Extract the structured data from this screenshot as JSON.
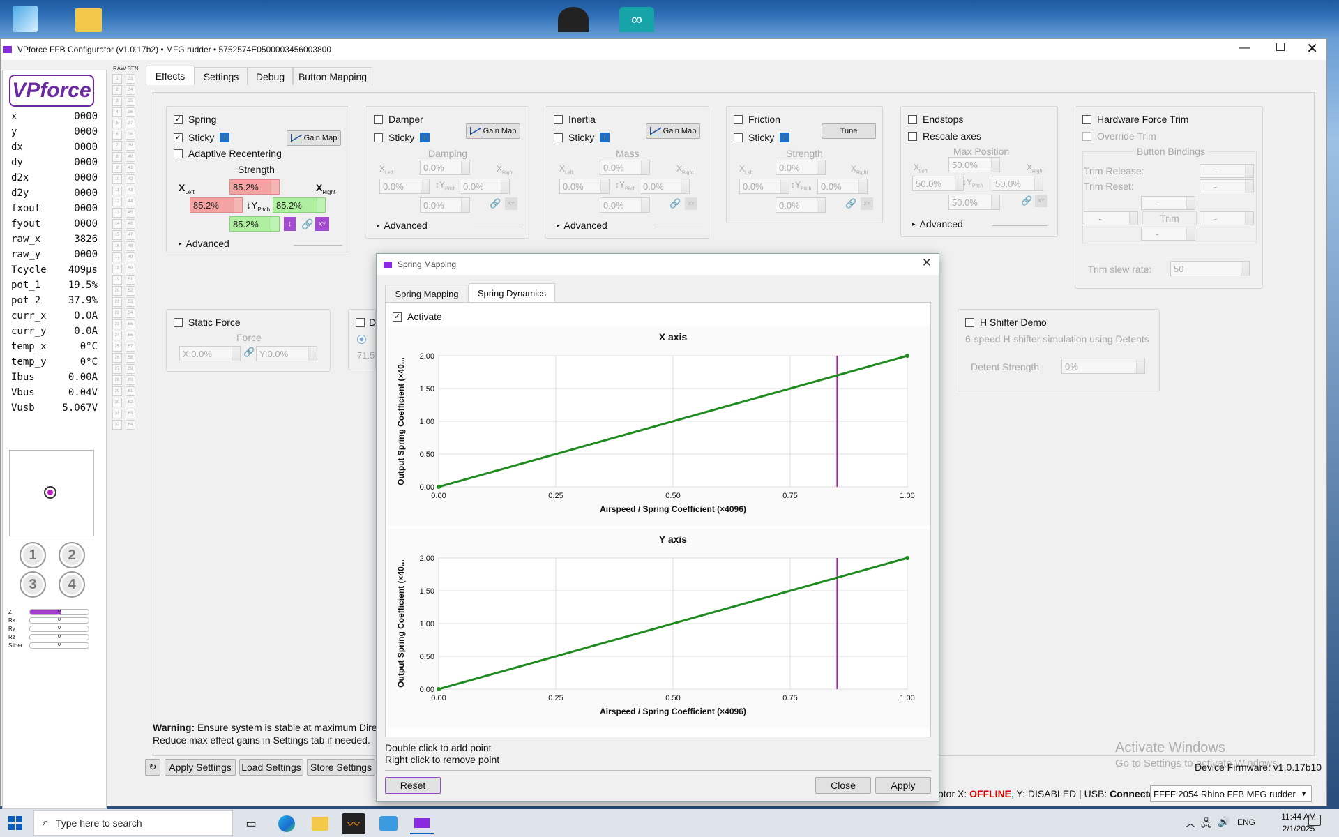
{
  "window": {
    "title": "VPforce FFB Configurator (v1.0.17b2) • MFG rudder • 5752574E0500003456003800"
  },
  "logo": "VPforce",
  "telemetry": [
    {
      "k": "x",
      "v": "0000"
    },
    {
      "k": "y",
      "v": "0000"
    },
    {
      "k": "dx",
      "v": "0000"
    },
    {
      "k": "dy",
      "v": "0000"
    },
    {
      "k": "d2x",
      "v": "0000"
    },
    {
      "k": "d2y",
      "v": "0000"
    },
    {
      "k": "fxout",
      "v": "0000"
    },
    {
      "k": "fyout",
      "v": "0000"
    },
    {
      "k": "raw_x",
      "v": "3826"
    },
    {
      "k": "raw_y",
      "v": "0000"
    },
    {
      "k": "Tcycle",
      "v": "409μs"
    },
    {
      "k": "pot_1",
      "v": "19.5%"
    },
    {
      "k": "pot_2",
      "v": "37.9%"
    },
    {
      "k": "curr_x",
      "v": "0.0A"
    },
    {
      "k": "curr_y",
      "v": "0.0A"
    },
    {
      "k": "temp_x",
      "v": "0°C"
    },
    {
      "k": "temp_y",
      "v": "0°C"
    },
    {
      "k": "Ibus",
      "v": "0.00A"
    },
    {
      "k": "Vbus",
      "v": "0.04V"
    },
    {
      "k": "Vusb",
      "v": "5.067V"
    }
  ],
  "hat_buttons": [
    "1",
    "2",
    "3",
    "4"
  ],
  "axes_bars": [
    {
      "label": "Z",
      "value": "0",
      "fill": 0.52
    },
    {
      "label": "Rx",
      "value": "0",
      "fill": 0
    },
    {
      "label": "Ry",
      "value": "0",
      "fill": 0
    },
    {
      "label": "Rz",
      "value": "0",
      "fill": 0
    },
    {
      "label": "Slider",
      "value": "0",
      "fill": 0
    }
  ],
  "raw_btn_header": "RAW BTN",
  "raw_btn_count": 64,
  "main_tabs": [
    "Effects",
    "Settings",
    "Debug",
    "Button Mapping"
  ],
  "spring": {
    "label": "Spring",
    "sticky": "Sticky",
    "info": "i",
    "gain_map": "Gain Map",
    "adaptive": "Adaptive Recentering",
    "strength": "Strength",
    "x_left": "X",
    "x_left_sub": "Left",
    "x_right": "X",
    "x_right_sub": "Right",
    "y_pitch": "↕Y",
    "y_pitch_sub": "Pitch",
    "v_top": "85.2%",
    "v_left": "85.2%",
    "v_right": "85.2%",
    "v_bottom": "85.2%",
    "link_i": "↕",
    "xy": "XY",
    "advanced": "Advanced",
    "check_mark": "✓"
  },
  "damper": {
    "label": "Damper",
    "sticky": "Sticky",
    "info": "i",
    "gain_map": "Gain Map",
    "group": "Damping",
    "v1": "0.0%",
    "v2": "0.0%",
    "v3": "0.0%",
    "v4": "0.0%",
    "advanced": "Advanced"
  },
  "inertia": {
    "label": "Inertia",
    "sticky": "Sticky",
    "info": "i",
    "gain_map": "Gain Map",
    "group": "Mass",
    "v1": "0.0%",
    "v2": "0.0%",
    "v3": "0.0%",
    "v4": "0.0%",
    "advanced": "Advanced"
  },
  "friction": {
    "label": "Friction",
    "sticky": "Sticky",
    "info": "i",
    "tune": "Tune",
    "group": "Strength",
    "v1": "0.0%",
    "v2": "0.0%",
    "v3": "0.0%",
    "v4": "0.0%"
  },
  "endstops": {
    "label": "Endstops",
    "rescale": "Rescale axes",
    "group": "Max Position",
    "v1": "50.0%",
    "v2": "50.0%",
    "v3": "50.0%",
    "v4": "50.0%",
    "advanced": "Advanced"
  },
  "xy_sub": {
    "x_left": "X",
    "left": "Left",
    "x_right": "X",
    "right": "Right",
    "y": "↕Y",
    "pitch": "Pitch",
    "xy": "XY"
  },
  "hw_trim": {
    "label": "Hardware Force Trim",
    "override": "Override Trim",
    "bindings": "Button Bindings",
    "trim_release": "Trim Release:",
    "trim_reset": "Trim Reset:",
    "trim": "Trim",
    "dash": "-",
    "slew_label": "Trim slew rate:",
    "slew_value": "50"
  },
  "static_force": {
    "label": "Static Force",
    "group": "Force",
    "x": "X:0.0%",
    "y": "Y:0.0%"
  },
  "partial_panel": {
    "label": "De",
    "value": "71.5"
  },
  "h_shifter": {
    "label": "H Shifter Demo",
    "desc": "6-speed H-shifter simulation using Detents",
    "strength_label": "Detent Strength",
    "strength_value": "0%"
  },
  "warning": {
    "bold": "Warning:",
    "line1": " Ensure system is stable at maximum Direc",
    "line2": "Reduce max effect gains in Settings tab if needed."
  },
  "bottom_buttons": {
    "refresh": "↻",
    "apply": "Apply Settings",
    "load": "Load Settings",
    "store": "Store Settings"
  },
  "status": {
    "prefix": "otor X: ",
    "offline": "OFFLINE",
    "mid": ", Y: DISABLED | USB: ",
    "connected": "Connected"
  },
  "device_select": "FFFF:2054 Rhino FFB MFG rudder",
  "firmware": "Device Firmware: v1.0.17b10",
  "activate_windows": {
    "title": "Activate Windows",
    "sub": "Go to Settings to activate Windows."
  },
  "dialog": {
    "title": "Spring Mapping",
    "tabs": [
      "Spring Mapping",
      "Spring Dynamics"
    ],
    "activate": "Activate",
    "hint1": "Double click to add point",
    "hint2": "Right click to remove point",
    "reset": "Reset",
    "close": "Close",
    "apply": "Apply"
  },
  "chart_data": [
    {
      "type": "line",
      "title": "X axis",
      "xlabel": "Airspeed / Spring Coefficient (×4096)",
      "ylabel": "Output Spring Coefficient (×40...",
      "xlim": [
        0,
        1
      ],
      "ylim": [
        0,
        2
      ],
      "xticks": [
        "0.00",
        "0.25",
        "0.50",
        "0.75",
        "1.00"
      ],
      "yticks": [
        "0.00",
        "0.50",
        "1.00",
        "1.50",
        "2.00"
      ],
      "series": [
        {
          "x": [
            0,
            1
          ],
          "y": [
            0,
            2
          ]
        }
      ],
      "marker_x": 0.85,
      "line_color": "#1f8a1f",
      "marker_color": "#c000c0"
    },
    {
      "type": "line",
      "title": "Y axis",
      "xlabel": "Airspeed / Spring Coefficient (×4096)",
      "ylabel": "Output Spring Coefficient (×40...",
      "xlim": [
        0,
        1
      ],
      "ylim": [
        0,
        2
      ],
      "xticks": [
        "0.00",
        "0.25",
        "0.50",
        "0.75",
        "1.00"
      ],
      "yticks": [
        "0.00",
        "0.50",
        "1.00",
        "1.50",
        "2.00"
      ],
      "series": [
        {
          "x": [
            0,
            1
          ],
          "y": [
            0,
            2
          ]
        }
      ],
      "marker_x": 0.85,
      "line_color": "#1f8a1f",
      "marker_color": "#c000c0"
    }
  ],
  "taskbar": {
    "search": "Type here to search",
    "lang": "ENG",
    "time": "11:44 AM",
    "date": "2/1/2025"
  }
}
